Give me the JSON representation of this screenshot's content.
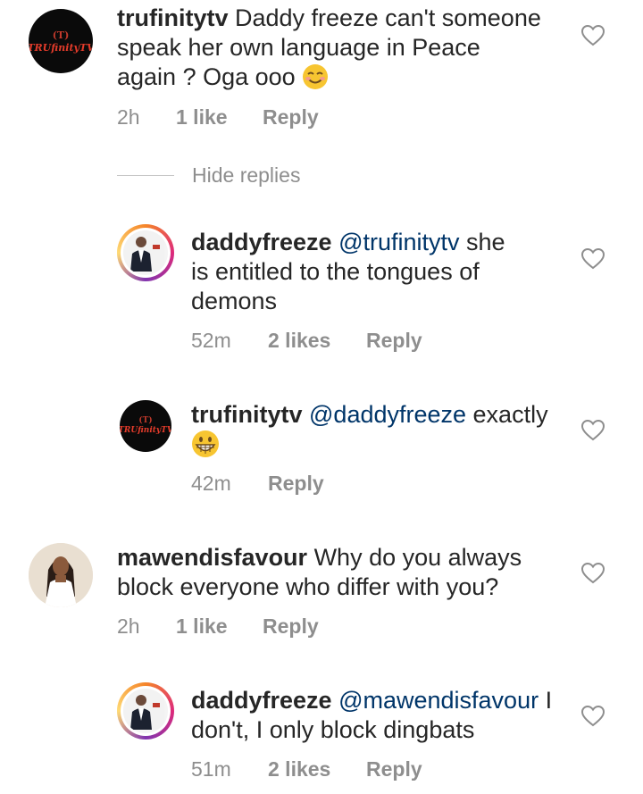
{
  "comments": [
    {
      "username": "trufinitytv",
      "text": " Daddy freeze can't someone speak her own language in Peace again ? Oga ooo ",
      "line1": " Daddy freeze can't someone",
      "line2": "speak her own language in Peace",
      "line3": "again ? Oga ooo ",
      "emoji": "smiling-face-emoji",
      "time": "2h",
      "likes": "1 like",
      "reply": "Reply",
      "avatar_logo_top": "(T)",
      "avatar_logo_name": "TRUfinityTV"
    },
    {
      "username": "daddyfreeze",
      "mention": "@trufinitytv",
      "line1_after": " she",
      "line2": "is entitled to the tongues of",
      "line3": "demons",
      "time": "52m",
      "likes": "2 likes",
      "reply": "Reply"
    },
    {
      "username": "trufinitytv",
      "mention": "@daddyfreeze",
      "line1_after": " exactly",
      "emoji": "grinning-face-emoji",
      "time": "42m",
      "reply": "Reply",
      "avatar_logo_top": "(T)",
      "avatar_logo_name": "TRUfinityTV"
    },
    {
      "username": "mawendisfavour",
      "line1": " Why do you always",
      "line2": "block everyone who differ with you?",
      "time": "2h",
      "likes": "1 like",
      "reply": "Reply"
    },
    {
      "username": "daddyfreeze",
      "mention": "@mawendisfavour",
      "line1_after": " I",
      "line2": "don't, I only block dingbats",
      "time": "51m",
      "likes": "2 likes",
      "reply": "Reply"
    }
  ],
  "hide_replies": "Hide replies",
  "colors": {
    "text": "#262626",
    "meta": "#8e8e8e",
    "mention": "#003569",
    "heart": "#8e8e8e"
  }
}
